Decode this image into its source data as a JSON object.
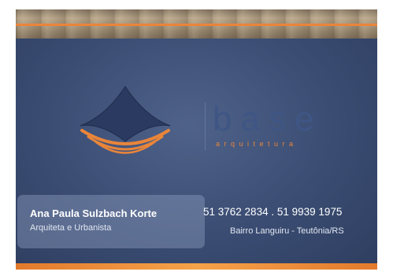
{
  "brand": {
    "name": "base",
    "tagline": "arquitetura"
  },
  "contact": {
    "name": "Ana Paula Sulzbach Korte",
    "title": "Arquiteta e Urbanista",
    "phones": "51 3762 2834 . 51 9939 1975",
    "address": "Bairro Languiru - Teutônia/RS"
  },
  "colors": {
    "background": "#3a4c72",
    "accent_orange": "#e9853a",
    "brand_blue": "#3f5685",
    "wood": "#a8967b"
  }
}
